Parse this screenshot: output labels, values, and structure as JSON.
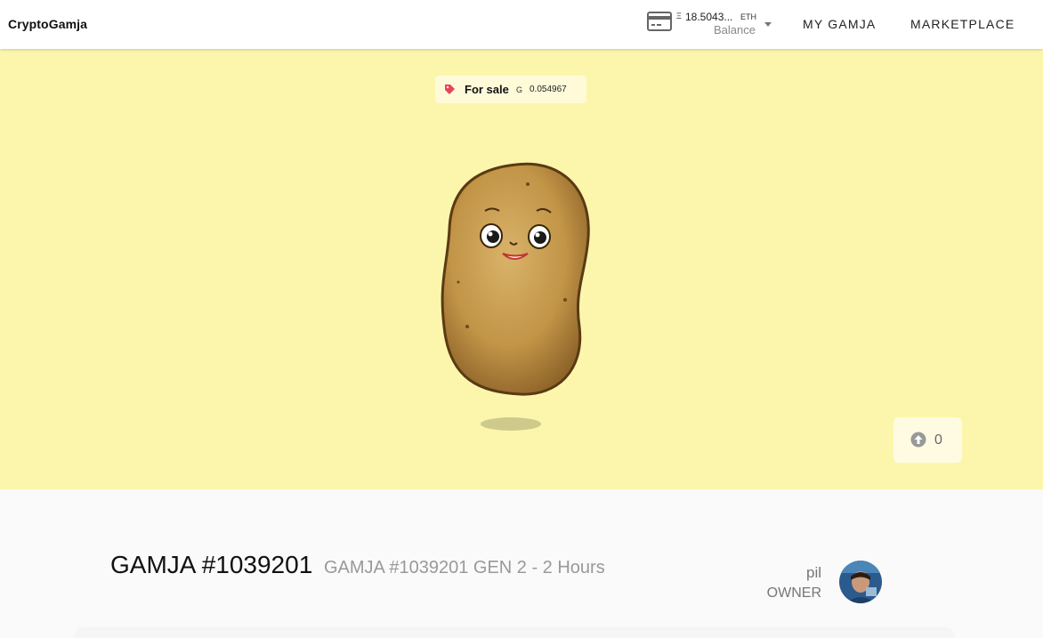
{
  "header": {
    "logo": "CryptoGamja",
    "balance": {
      "symbol": "Ξ",
      "amount": "18.5043...",
      "unit": "ETH",
      "label": "Balance"
    },
    "nav": {
      "my_gamja": "MY GAMJA",
      "marketplace": "MARKETPLACE"
    }
  },
  "hero": {
    "sale": {
      "label": "For sale",
      "symbol": "G",
      "price": "0.054967"
    },
    "likes": "0"
  },
  "details": {
    "title": "GAMJA #1039201",
    "subtitle": "GAMJA #1039201 GEN 2 - 2 Hours",
    "owner_name": "pil",
    "owner_label": "OWNER"
  },
  "colors": {
    "hero_bg": "#fcf6ac",
    "tag": "#e8455a",
    "potato": "#c59a4e"
  }
}
